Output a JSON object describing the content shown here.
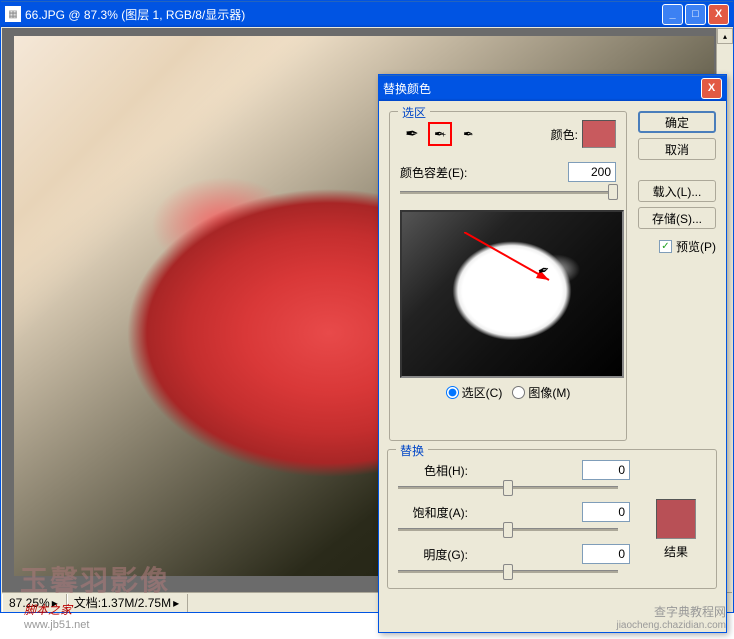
{
  "doc_window": {
    "title": "66.JPG @ 87.3% (图层 1, RGB/8/显示器)",
    "icon_glyph": "▦"
  },
  "win_buttons": {
    "min": "_",
    "max": "□",
    "close": "X"
  },
  "statusbar": {
    "zoom": "87.25%",
    "doc_info": "文档:1.37M/2.75M",
    "dropdown_glyph": "▸"
  },
  "watermarks": {
    "main": "玉馨羽影像",
    "left_text": "脚本之家",
    "left_url": "www.jb51.net",
    "right_text": "查字典教程网",
    "right_url": "jiaocheng.chazidian.com"
  },
  "dialog": {
    "title": "替换颜色",
    "selection_legend": "选区",
    "color_label": "颜色:",
    "swatch_color": "#c85a5e",
    "fuzziness_label": "颜色容差(E):",
    "fuzziness_value": "200",
    "radio_selection": "选区(C)",
    "radio_image": "图像(M)",
    "replace_legend": "替换",
    "hue_label": "色相(H):",
    "hue_value": "0",
    "sat_label": "饱和度(A):",
    "sat_value": "0",
    "light_label": "明度(G):",
    "light_value": "0",
    "result_label": "结果",
    "result_color": "#b85056",
    "eyedropper_glyph": "✒",
    "cursor_glyph": "✒"
  },
  "buttons": {
    "ok": "确定",
    "cancel": "取消",
    "load": "载入(L)...",
    "save": "存储(S)...",
    "preview": "预览(P)",
    "check_glyph": "✓"
  }
}
